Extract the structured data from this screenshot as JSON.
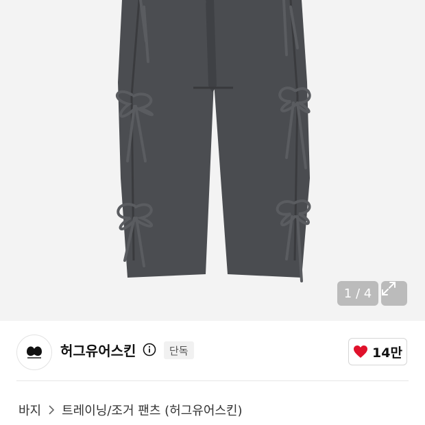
{
  "product_image": {
    "description_icon": "grey-pants-with-ribbon-ties-image",
    "counter": "1 / 4"
  },
  "brand": {
    "name": "허그유어스킨",
    "badge": "단독",
    "like_count": "14만",
    "like_color": "#e0112b"
  },
  "breadcrumb": {
    "items": [
      "바지",
      "트레이닝/조거 팬츠 (허그유어스킨)"
    ]
  }
}
